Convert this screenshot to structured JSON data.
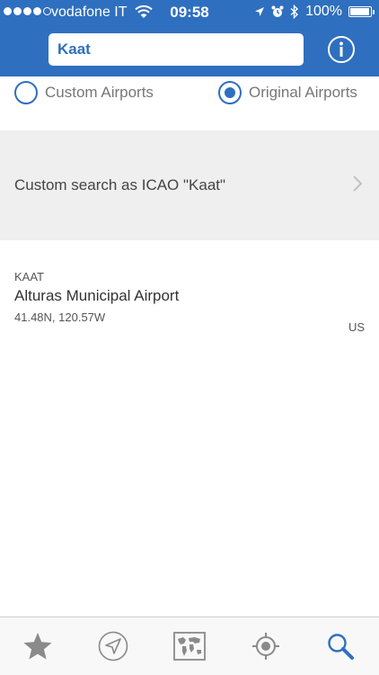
{
  "status_bar": {
    "carrier": "vodafone IT",
    "time": "09:58",
    "battery_text": "100%",
    "battery_level": 1.0
  },
  "search": {
    "value": "Kaat",
    "placeholder": ""
  },
  "filters": {
    "custom_label": "Custom Airports",
    "original_label": "Original Airports",
    "selected": "original"
  },
  "custom_search": {
    "label": "Custom search as ICAO \"Kaat\""
  },
  "results": [
    {
      "icao": "KAAT",
      "name": "Alturas Municipal Airport",
      "coords": "41.48N, 120.57W",
      "country": "US"
    }
  ],
  "tabs": [
    {
      "icon": "star-icon",
      "active": false
    },
    {
      "icon": "navigation-arrow-icon",
      "active": false
    },
    {
      "icon": "world-map-icon",
      "active": false
    },
    {
      "icon": "location-target-icon",
      "active": false
    },
    {
      "icon": "search-icon",
      "active": true
    }
  ],
  "colors": {
    "accent": "#2f6fbf",
    "tab_inactive": "#8a8a8a",
    "row_background": "#efefef"
  }
}
